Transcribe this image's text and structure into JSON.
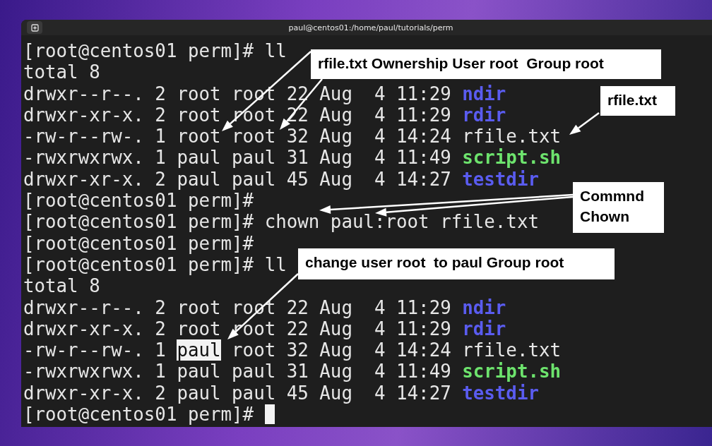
{
  "window": {
    "title": "paul@centos01:/home/paul/tutorials/perm"
  },
  "terminal": {
    "lines": [
      {
        "segments": [
          {
            "text": "[root@centos01 perm]# ll",
            "kind": "plain"
          }
        ]
      },
      {
        "segments": [
          {
            "text": "total 8",
            "kind": "plain"
          }
        ]
      },
      {
        "segments": [
          {
            "text": "drwxr--r--. 2 root root 22 Aug  4 11:29 ",
            "kind": "plain"
          },
          {
            "text": "ndir",
            "kind": "dir"
          }
        ]
      },
      {
        "segments": [
          {
            "text": "drwxr-xr-x. 2 root root 22 Aug  4 11:29 ",
            "kind": "plain"
          },
          {
            "text": "rdir",
            "kind": "dir"
          }
        ]
      },
      {
        "segments": [
          {
            "text": "-rw-r--rw-. 1 root root 32 Aug  4 14:24 rfile.txt",
            "kind": "plain"
          }
        ]
      },
      {
        "segments": [
          {
            "text": "-rwxrwxrwx. 1 paul paul 31 Aug  4 11:49 ",
            "kind": "plain"
          },
          {
            "text": "script.sh",
            "kind": "exec"
          }
        ]
      },
      {
        "segments": [
          {
            "text": "drwxr-xr-x. 2 paul paul 45 Aug  4 14:27 ",
            "kind": "plain"
          },
          {
            "text": "testdir",
            "kind": "dir"
          }
        ]
      },
      {
        "segments": [
          {
            "text": "[root@centos01 perm]#",
            "kind": "plain"
          }
        ]
      },
      {
        "segments": [
          {
            "text": "[root@centos01 perm]# chown paul:root rfile.txt",
            "kind": "plain"
          }
        ]
      },
      {
        "segments": [
          {
            "text": "[root@centos01 perm]#",
            "kind": "plain"
          }
        ]
      },
      {
        "segments": [
          {
            "text": "[root@centos01 perm]# ll",
            "kind": "plain"
          }
        ]
      },
      {
        "segments": [
          {
            "text": "total 8",
            "kind": "plain"
          }
        ]
      },
      {
        "segments": [
          {
            "text": "drwxr--r--. 2 root root 22 Aug  4 11:29 ",
            "kind": "plain"
          },
          {
            "text": "ndir",
            "kind": "dir"
          }
        ]
      },
      {
        "segments": [
          {
            "text": "drwxr-xr-x. 2 root root 22 Aug  4 11:29 ",
            "kind": "plain"
          },
          {
            "text": "rdir",
            "kind": "dir"
          }
        ]
      },
      {
        "segments": [
          {
            "text": "-rw-r--rw-. 1 ",
            "kind": "plain"
          },
          {
            "text": "paul",
            "kind": "highlight"
          },
          {
            "text": " root 32 Aug  4 14:24 rfile.txt",
            "kind": "plain"
          }
        ]
      },
      {
        "segments": [
          {
            "text": "-rwxrwxrwx. 1 paul paul 31 Aug  4 11:49 ",
            "kind": "plain"
          },
          {
            "text": "script.sh",
            "kind": "exec"
          }
        ]
      },
      {
        "segments": [
          {
            "text": "drwxr-xr-x. 2 paul paul 45 Aug  4 14:27 ",
            "kind": "plain"
          },
          {
            "text": "testdir",
            "kind": "dir"
          }
        ]
      },
      {
        "segments": [
          {
            "text": "[root@centos01 perm]# ",
            "kind": "plain"
          }
        ],
        "cursor": true
      }
    ]
  },
  "annotations": [
    {
      "lines": [
        "rfile.txt Ownership User root  Group root"
      ]
    },
    {
      "lines": [
        "rfile.txt"
      ]
    },
    {
      "lines": [
        "Commnd",
        "Chown"
      ]
    },
    {
      "lines": [
        "change user root  to paul Group root"
      ]
    }
  ]
}
